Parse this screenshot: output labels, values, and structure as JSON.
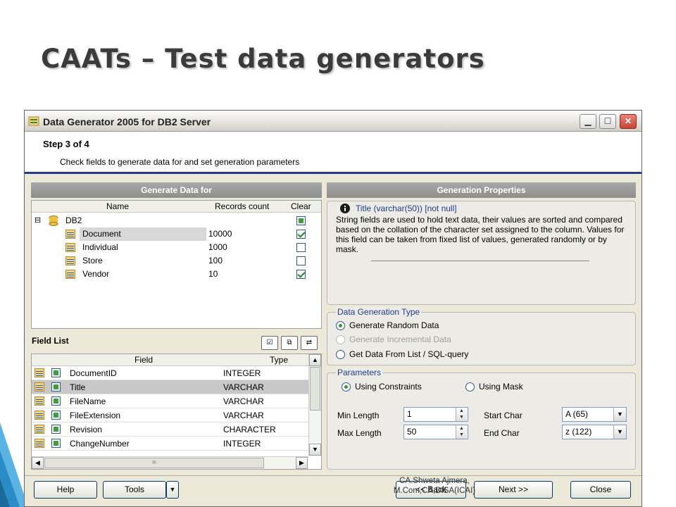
{
  "slide": {
    "title": "CAATs – Test data generators",
    "footer": "CA.Shweta Ajmera, M.Com,CA,DISA(ICAI)"
  },
  "window": {
    "title": "Data Generator 2005 for DB2 Server",
    "minimize_icon": "minimize-icon",
    "maximize_icon": "maximize-icon",
    "close_icon": "close-icon"
  },
  "header": {
    "step": "Step 3 of 4",
    "description": "Check fields to generate data for and set generation parameters"
  },
  "left": {
    "title": "Generate Data for",
    "columns": {
      "name": "Name",
      "records": "Records count",
      "clear": "Clear"
    },
    "root": "DB2",
    "tables": [
      {
        "name": "Document",
        "records": "10000",
        "checked": true
      },
      {
        "name": "Individual",
        "records": "1000",
        "checked": false
      },
      {
        "name": "Store",
        "records": "100",
        "checked": false
      },
      {
        "name": "Vendor",
        "records": "10",
        "checked": true
      }
    ],
    "field_list_label": "Field List",
    "field_columns": {
      "field": "Field",
      "type": "Type"
    },
    "fields": [
      {
        "field": "DocumentID",
        "type": "INTEGER"
      },
      {
        "field": "Title",
        "type": "VARCHAR"
      },
      {
        "field": "FileName",
        "type": "VARCHAR"
      },
      {
        "field": "FileExtension",
        "type": "VARCHAR"
      },
      {
        "field": "Revision",
        "type": "CHARACTER"
      },
      {
        "field": "ChangeNumber",
        "type": "INTEGER"
      }
    ],
    "hscroll_grip": "III"
  },
  "right": {
    "title": "Generation Properties",
    "info_title": "Title (varchar(50)) [not null]",
    "info_text": "String fields are used to hold text data, their values are sorted and compared based on the collation of the character set assigned to the column. Values for this field can be taken from fixed list of values, generated randomly or by mask.",
    "dgt_label": "Data Generation Type",
    "dgt_options": [
      "Generate Random Data",
      "Generate Incremental Data",
      "Get Data From List / SQL-query"
    ],
    "params_label": "Parameters",
    "param_modes": [
      "Using Constraints",
      "Using Mask"
    ],
    "min_length_label": "Min Length",
    "min_length": "1",
    "max_length_label": "Max Length",
    "max_length": "50",
    "start_char_label": "Start Char",
    "start_char": "A (65)",
    "end_char_label": "End Char",
    "end_char": "z (122)"
  },
  "buttons": {
    "help": "Help",
    "tools": "Tools",
    "back": "<< Back",
    "next": "Next >>",
    "close": "Close"
  }
}
